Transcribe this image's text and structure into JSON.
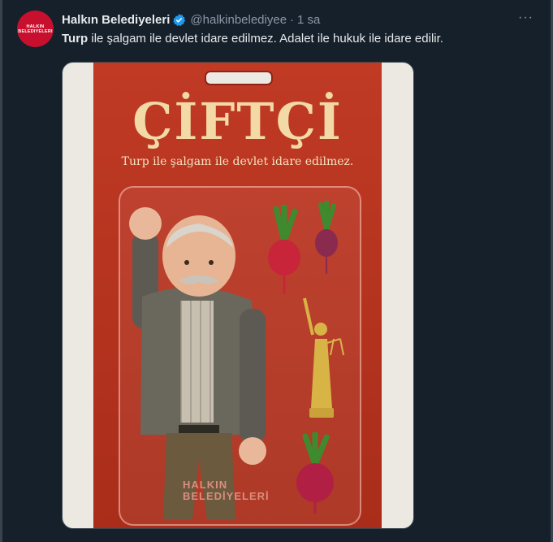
{
  "tweet": {
    "avatar_line1": "HALKIN",
    "avatar_line2": "BELEDIYELERI",
    "display_name": "Halkın Belediyeleri",
    "handle": "@halkinbelediyee",
    "separator": "·",
    "time": "1 sa",
    "more": "···",
    "text_bold": "Turp",
    "text_rest": " ile şalgam ile devlet idare edilmez. Adalet ile hukuk ile idare edilir."
  },
  "media": {
    "package_title": "ÇİFTÇİ",
    "package_subtitle": "Turp ile şalgam ile devlet idare edilmez.",
    "brand_line1": "HALKIN",
    "brand_line2": "BELEDİYELERİ"
  },
  "colors": {
    "background": "#15202b",
    "card_red": "#b8321e",
    "verified_blue": "#1d9bf0"
  }
}
